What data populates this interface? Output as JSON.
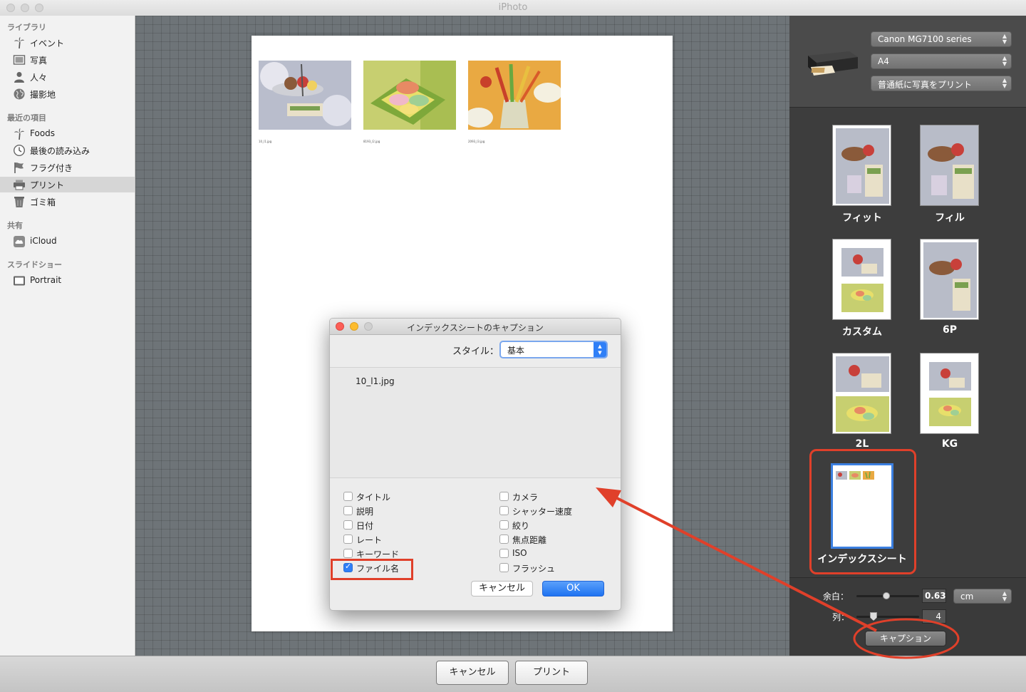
{
  "window": {
    "title": "iPhoto"
  },
  "sidebar": {
    "sections": [
      {
        "label": "ライブラリ",
        "items": [
          {
            "label": "イベント",
            "icon": "palm-tree-icon"
          },
          {
            "label": "写真",
            "icon": "photo-icon"
          },
          {
            "label": "人々",
            "icon": "person-icon"
          },
          {
            "label": "撮影地",
            "icon": "globe-icon"
          }
        ]
      },
      {
        "label": "最近の項目",
        "items": [
          {
            "label": "Foods",
            "icon": "palm-tree-icon"
          },
          {
            "label": "最後の読み込み",
            "icon": "clock-icon"
          },
          {
            "label": "フラグ付き",
            "icon": "flag-icon"
          },
          {
            "label": "プリント",
            "icon": "printer-icon",
            "selected": true
          },
          {
            "label": "ゴミ箱",
            "icon": "trash-icon"
          }
        ]
      },
      {
        "label": "共有",
        "items": [
          {
            "label": "iCloud",
            "icon": "cloud-icon"
          }
        ]
      },
      {
        "label": "スライドショー",
        "items": [
          {
            "label": "Portrait",
            "icon": "slideshow-icon"
          }
        ]
      }
    ]
  },
  "preview": {
    "captions": [
      "10_l1.jpg",
      "8193_l2.jpg",
      "2093_l3.jpg"
    ]
  },
  "printer": {
    "printer_name": "Canon MG7100 series",
    "paper_size": "A4",
    "preset": "普通紙に写真をプリント"
  },
  "layouts": [
    {
      "label": "フィット"
    },
    {
      "label": "フィル"
    },
    {
      "label": "カスタム"
    },
    {
      "label": "6P"
    },
    {
      "label": "2L"
    },
    {
      "label": "KG"
    },
    {
      "label": "インデックスシート",
      "selected": true
    }
  ],
  "controls": {
    "margin_label": "余白：",
    "margin_value": "0.63",
    "margin_unit": "cm",
    "columns_label": "列：",
    "columns_value": "4",
    "caption_button": "キャプション"
  },
  "footer": {
    "cancel_label": "キャンセル",
    "print_label": "プリント"
  },
  "dialog": {
    "title": "インデックスシートのキャプション",
    "style_label": "スタイル：",
    "style_value": "基本",
    "preview_text": "10_l1.jpg",
    "options_left": [
      {
        "label": "タイトル",
        "checked": false
      },
      {
        "label": "説明",
        "checked": false
      },
      {
        "label": "日付",
        "checked": false
      },
      {
        "label": "レート",
        "checked": false
      },
      {
        "label": "キーワード",
        "checked": false
      },
      {
        "label": "ファイル名",
        "checked": true
      }
    ],
    "options_right": [
      {
        "label": "カメラ",
        "checked": false
      },
      {
        "label": "シャッター速度",
        "checked": false
      },
      {
        "label": "絞り",
        "checked": false
      },
      {
        "label": "焦点距離",
        "checked": false
      },
      {
        "label": "ISO",
        "checked": false
      },
      {
        "label": "フラッシュ",
        "checked": false
      }
    ],
    "cancel_label": "キャンセル",
    "ok_label": "OK"
  },
  "colors": {
    "annotation_red": "#e0402a",
    "accent_blue": "#2f7ff7",
    "sidebar_selected": "#d6d6d6"
  }
}
